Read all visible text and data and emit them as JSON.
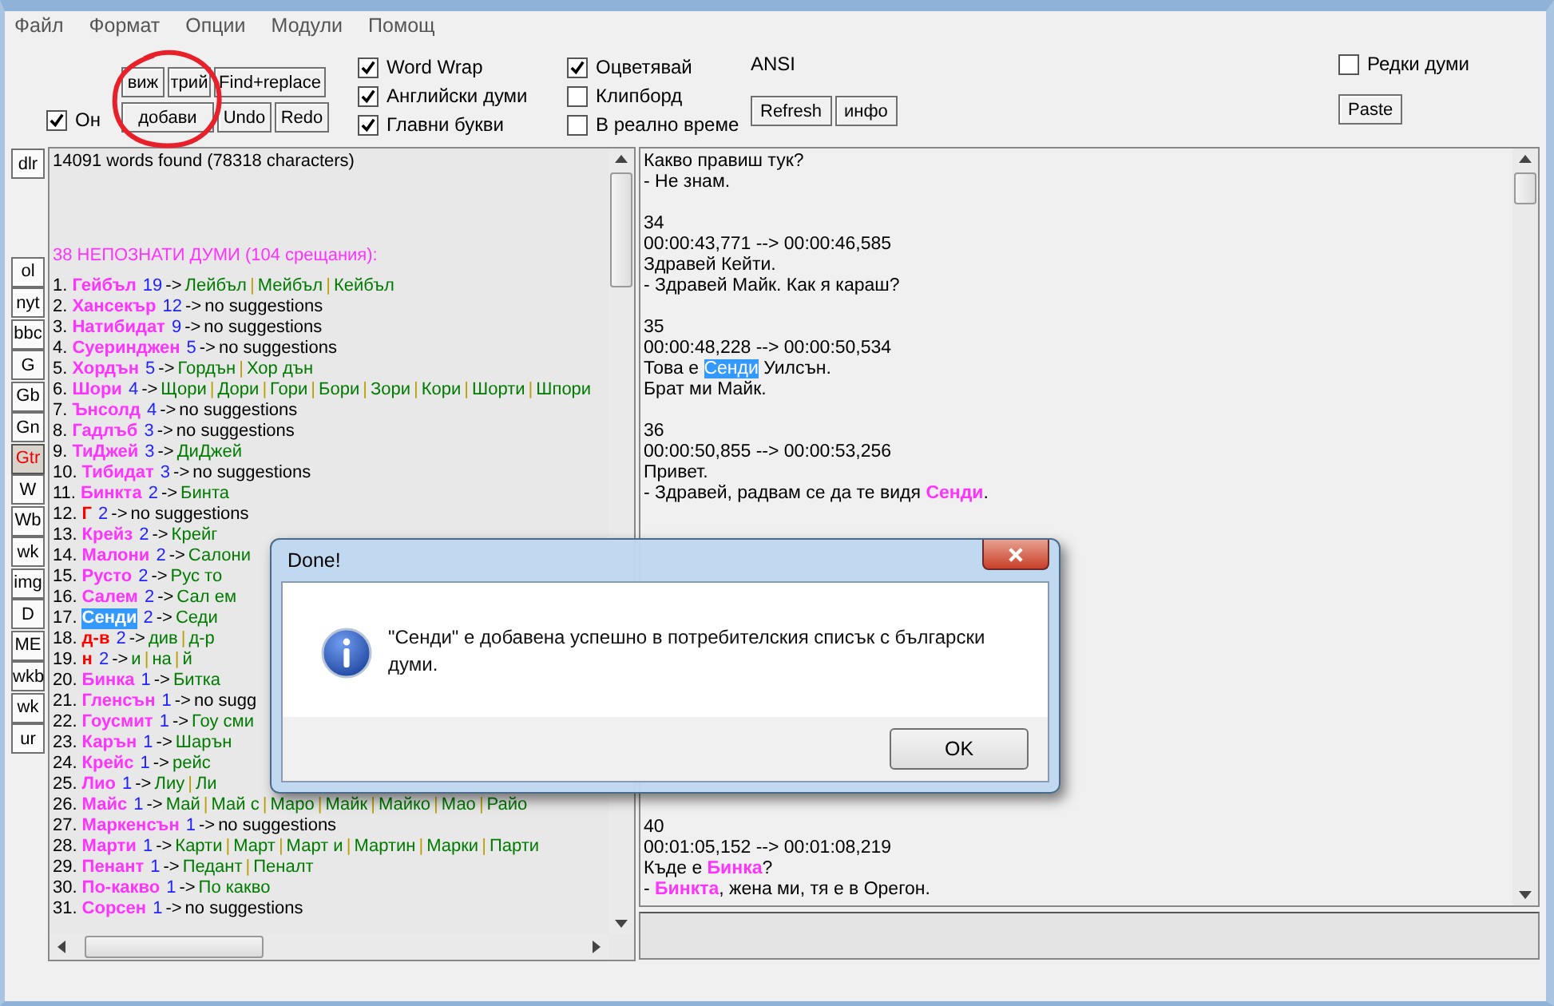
{
  "menu": [
    "Файл",
    "Формат",
    "Опции",
    "Модули",
    "Помощ"
  ],
  "toolbar": {
    "online": {
      "label": "Он",
      "checked": true
    },
    "buttons_top": [
      "виж",
      "трий",
      "Find+replace"
    ],
    "buttons_bottom": [
      "добави",
      "Undo",
      "Redo"
    ],
    "checks_1": [
      {
        "label": "Word Wrap",
        "checked": true
      },
      {
        "label": "Английски думи",
        "checked": true
      },
      {
        "label": "Главни букви",
        "checked": true
      }
    ],
    "checks_2": [
      {
        "label": "Оцветявай",
        "checked": true
      },
      {
        "label": "Клипборд",
        "checked": false
      },
      {
        "label": "В реално време",
        "checked": false
      }
    ],
    "encoding": "ANSI",
    "buttons_mid": [
      "Refresh",
      "инфо"
    ],
    "rare_words": {
      "label": "Редки думи",
      "checked": false
    },
    "paste": "Paste"
  },
  "side_buttons_top": [
    {
      "label": "dlr",
      "selected": false
    }
  ],
  "side_buttons": [
    {
      "label": "ol",
      "selected": false
    },
    {
      "label": "nyt",
      "selected": false
    },
    {
      "label": "bbc",
      "selected": false
    },
    {
      "label": "G",
      "selected": false
    },
    {
      "label": "Gb",
      "selected": false
    },
    {
      "label": "Gn",
      "selected": false
    },
    {
      "label": "Gtr",
      "selected": true
    },
    {
      "label": "W",
      "selected": false
    },
    {
      "label": "Wb",
      "selected": false
    },
    {
      "label": "wk",
      "selected": false
    },
    {
      "label": "img",
      "selected": false
    },
    {
      "label": "D",
      "selected": false
    },
    {
      "label": "ME",
      "selected": false
    },
    {
      "label": "wkb",
      "selected": false
    },
    {
      "label": "wk",
      "selected": false
    },
    {
      "label": "ur",
      "selected": false
    }
  ],
  "word_list": {
    "summary": "14091 words found (78318 characters)",
    "heading": "38 НЕПОЗНАТИ ДУМИ (104 срещания):",
    "arrow": "->",
    "separator": "|",
    "rows": [
      {
        "num": "1.",
        "word": "Гейбъл",
        "kind": "name",
        "selected": false,
        "count": "19",
        "suggestions": [
          "Лейбъл",
          "Мейбъл",
          "Кейбъл"
        ]
      },
      {
        "num": "2.",
        "word": "Хансекър",
        "kind": "name",
        "selected": false,
        "count": "12",
        "note": "no suggestions"
      },
      {
        "num": "3.",
        "word": "Натибидат",
        "kind": "name",
        "selected": false,
        "count": "9",
        "note": "no suggestions"
      },
      {
        "num": "4.",
        "word": "Суеринджен",
        "kind": "name",
        "selected": false,
        "count": "5",
        "note": "no suggestions"
      },
      {
        "num": "5.",
        "word": "Хордън",
        "kind": "name",
        "selected": false,
        "count": "5",
        "suggestions": [
          "Гордън",
          "Хор дън"
        ]
      },
      {
        "num": "6.",
        "word": "Шори",
        "kind": "name",
        "selected": false,
        "count": "4",
        "suggestions": [
          "Щори",
          "Дори",
          "Гори",
          "Бори",
          "Зори",
          "Кори",
          "Шорти",
          "Шпори"
        ]
      },
      {
        "num": "7.",
        "word": "Ънсолд",
        "kind": "name",
        "selected": false,
        "count": "4",
        "note": "no suggestions"
      },
      {
        "num": "8.",
        "word": "Гадлъб",
        "kind": "name",
        "selected": false,
        "count": "3",
        "note": "no suggestions"
      },
      {
        "num": "9.",
        "word": "ТиДжей",
        "kind": "name",
        "selected": false,
        "count": "3",
        "suggestions": [
          "ДиДжей"
        ]
      },
      {
        "num": "10.",
        "word": "Тибидат",
        "kind": "name",
        "selected": false,
        "count": "3",
        "note": "no suggestions"
      },
      {
        "num": "11.",
        "word": "Бинкта",
        "kind": "name",
        "selected": false,
        "count": "2",
        "suggestions": [
          "Бинта"
        ]
      },
      {
        "num": "12.",
        "word": "Г",
        "kind": "fragment",
        "selected": false,
        "count": "2",
        "note": "no suggestions"
      },
      {
        "num": "13.",
        "word": "Крейз",
        "kind": "name",
        "selected": false,
        "count": "2",
        "suggestions": [
          "Крейг"
        ]
      },
      {
        "num": "14.",
        "word": "Малони",
        "kind": "name",
        "selected": false,
        "count": "2",
        "suggestions": [
          "Салони"
        ]
      },
      {
        "num": "15.",
        "word": "Русто",
        "kind": "name",
        "selected": false,
        "count": "2",
        "suggestions": [
          "Рус то"
        ]
      },
      {
        "num": "16.",
        "word": "Салем",
        "kind": "name",
        "selected": false,
        "count": "2",
        "suggestions": [
          "Сал ем"
        ]
      },
      {
        "num": "17.",
        "word": "Сенди",
        "kind": "name",
        "selected": true,
        "count": "2",
        "suggestions": [
          "Седи"
        ]
      },
      {
        "num": "18.",
        "word": "д-в",
        "kind": "fragment",
        "selected": false,
        "count": "2",
        "suggestions": [
          "див",
          "д-р"
        ]
      },
      {
        "num": "19.",
        "word": "н",
        "kind": "fragment",
        "selected": false,
        "count": "2",
        "suggestions": [
          "и",
          "на",
          "й"
        ]
      },
      {
        "num": "20.",
        "word": "Бинка",
        "kind": "name",
        "selected": false,
        "count": "1",
        "suggestions": [
          "Битка"
        ]
      },
      {
        "num": "21.",
        "word": "Гленсън",
        "kind": "name",
        "selected": false,
        "count": "1",
        "note": "no sugg"
      },
      {
        "num": "22.",
        "word": "Гоусмит",
        "kind": "name",
        "selected": false,
        "count": "1",
        "suggestions": [
          "Гоу сми"
        ]
      },
      {
        "num": "23.",
        "word": "Карън",
        "kind": "name",
        "selected": false,
        "count": "1",
        "suggestions": [
          "Шарън"
        ]
      },
      {
        "num": "24.",
        "word": "Крейс",
        "kind": "name",
        "selected": false,
        "count": "1",
        "suggestions": [
          "рейс"
        ]
      },
      {
        "num": "25.",
        "word": "Лио",
        "kind": "name",
        "selected": false,
        "count": "1",
        "suggestions": [
          "Лиу",
          "Ли"
        ]
      },
      {
        "num": "26.",
        "word": "Майс",
        "kind": "name",
        "selected": false,
        "count": "1",
        "suggestions": [
          "Май",
          "Май с",
          "Маро",
          "Майк",
          "Майко",
          "Мао",
          "Райо"
        ]
      },
      {
        "num": "27.",
        "word": "Маркенсън",
        "kind": "name",
        "selected": false,
        "count": "1",
        "note": "no suggestions"
      },
      {
        "num": "28.",
        "word": "Марти",
        "kind": "name",
        "selected": false,
        "count": "1",
        "suggestions": [
          "Карти",
          "Март",
          "Март и",
          "Мартин",
          "Марки",
          "Парти"
        ]
      },
      {
        "num": "29.",
        "word": "Пенант",
        "kind": "name",
        "selected": false,
        "count": "1",
        "suggestions": [
          "Педант",
          "Пеналт"
        ]
      },
      {
        "num": "30.",
        "word": "По-какво",
        "kind": "name",
        "selected": false,
        "count": "1",
        "suggestions": [
          "По какво"
        ]
      },
      {
        "num": "31.",
        "word": "Сорсен",
        "kind": "name",
        "selected": false,
        "count": "1",
        "note": "no suggestions"
      }
    ]
  },
  "subtitles": [
    {
      "lines": [
        [
          {
            "kind": "plain",
            "text": "Какво правиш тук?"
          }
        ],
        [
          {
            "kind": "plain",
            "text": "- Не знам."
          }
        ]
      ]
    },
    {
      "number": "34",
      "time": "00:00:43,771 --> 00:00:46,585",
      "lines": [
        [
          {
            "kind": "plain",
            "text": "Здравей Кейти."
          }
        ],
        [
          {
            "kind": "plain",
            "text": "- Здравей Майк. Как я караш?"
          }
        ]
      ]
    },
    {
      "number": "35",
      "time": "00:00:48,228 --> 00:00:50,534",
      "lines": [
        [
          {
            "kind": "plain",
            "text": "Това е "
          },
          {
            "kind": "selected",
            "text": "Сенди"
          },
          {
            "kind": "plain",
            "text": " Уилсън."
          }
        ],
        [
          {
            "kind": "plain",
            "text": "Брат ми Майк."
          }
        ]
      ]
    },
    {
      "number": "36",
      "time": "00:00:50,855 --> 00:00:53,256",
      "lines": [
        [
          {
            "kind": "plain",
            "text": "Привет."
          }
        ],
        [
          {
            "kind": "plain",
            "text": "- Здравей, радвам се да те видя "
          },
          {
            "kind": "unknown",
            "text": "Сенди"
          },
          {
            "kind": "plain",
            "text": "."
          }
        ]
      ]
    },
    {
      "number": "40",
      "time": "00:01:05,152 --> 00:01:08,219",
      "lines": [
        [
          {
            "kind": "plain",
            "text": "Къде е "
          },
          {
            "kind": "unknown",
            "text": "Бинка"
          },
          {
            "kind": "plain",
            "text": "?"
          }
        ],
        [
          {
            "kind": "plain",
            "text": "- "
          },
          {
            "kind": "unknown",
            "text": "Бинкта"
          },
          {
            "kind": "plain",
            "text": ", жена ми, тя е в Орегон."
          }
        ]
      ]
    }
  ],
  "dialog": {
    "title": "Done!",
    "message": "\"Сенди\"  е добавена успешно в потребителския списък с български думи.",
    "button": "OK"
  }
}
